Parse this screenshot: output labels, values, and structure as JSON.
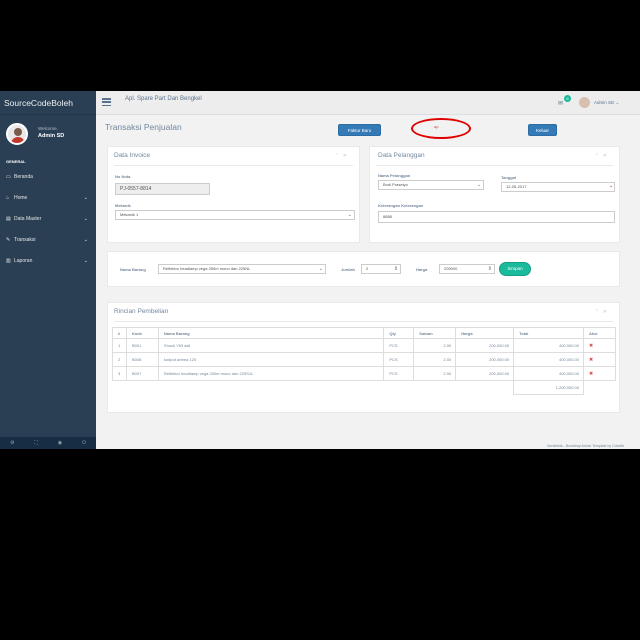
{
  "sidebar": {
    "brand": "SourceCodeBoleh",
    "welcome": "Welcome,",
    "user_name": "Admin SD",
    "section": "GENERAL",
    "items": [
      {
        "label": "Beranda",
        "icon": "laptop-icon",
        "glyph": "▭",
        "chevron": ""
      },
      {
        "label": "Home",
        "icon": "home-icon",
        "glyph": "⌂",
        "chevron": "⌄"
      },
      {
        "label": "Data Master",
        "icon": "table-icon",
        "glyph": "▤",
        "chevron": "⌄"
      },
      {
        "label": "Transaksi",
        "icon": "edit-icon",
        "glyph": "✎",
        "chevron": "⌄"
      },
      {
        "label": "Laporan",
        "icon": "bar-chart-icon",
        "glyph": "▥",
        "chevron": "⌄"
      }
    ],
    "footer_icons": [
      "⚙",
      "⛶",
      "◉",
      "⏻"
    ]
  },
  "topbar": {
    "app_title": "Apl. Spare Part Dan Bengkel",
    "badge_count": "6",
    "user_label": "Admin SD ⌄"
  },
  "page": {
    "title": "Transaksi Penjualan",
    "btn_new": "Faktur Baru",
    "btn_exit": "Keluar",
    "ellipse_label": "up"
  },
  "invoice": {
    "title": "Data Invoice",
    "no_label": "No Nota",
    "no_value": "PJ-0557-8814",
    "mekanik_label": "Mekanik",
    "mekanik_value": "Mekanik 1"
  },
  "pelanggan": {
    "title": "Data Pelanggan",
    "nama_label": "Nama Pelanggan",
    "nama_value": "Budi Prasetyo",
    "tanggal_label": "Tanggal",
    "tanggal_value": "12-05-2017",
    "ket_label": "Keterangan Keterangan",
    "ket_value": "8888"
  },
  "entry": {
    "barang_label": "Nama Barang",
    "barang_value": "Reflektor headlamp vega 250m mono dan 225NL",
    "jumlah_label": "Jumlah",
    "jumlah_value": "2",
    "harga_label": "Harga",
    "harga_value": "200000",
    "btn_simpan": "Simpan"
  },
  "rincian": {
    "title": "Rincian Pembelian",
    "headers": [
      "#",
      "Kode",
      "Nama Barang",
      "Qty",
      "Satuan",
      "Harga",
      "Total",
      "Aksi"
    ],
    "rows": [
      [
        "1",
        "B001",
        "Shock Y53 asli",
        "PCS",
        "2.00",
        "200,000.00",
        "400,000.00"
      ],
      [
        "2",
        "B008",
        "kodpot antrea 120",
        "PCS",
        "2.00",
        "200,000.00",
        "400,000.00"
      ],
      [
        "3",
        "B007",
        "Reflektor headlamp vega 250m mono dan 225S1L",
        "PCS",
        "2.00",
        "200,000.00",
        "400,000.00"
      ]
    ],
    "grand_total": "1,200,000.00"
  },
  "footer": "Gentelella - Bootstrap Admin Template by Colorlib",
  "colors": {
    "sidebar": "#2a3f54",
    "primary": "#337ab7",
    "success": "#1abb9c",
    "danger": "#d9534f",
    "highlight": "#e00000"
  }
}
